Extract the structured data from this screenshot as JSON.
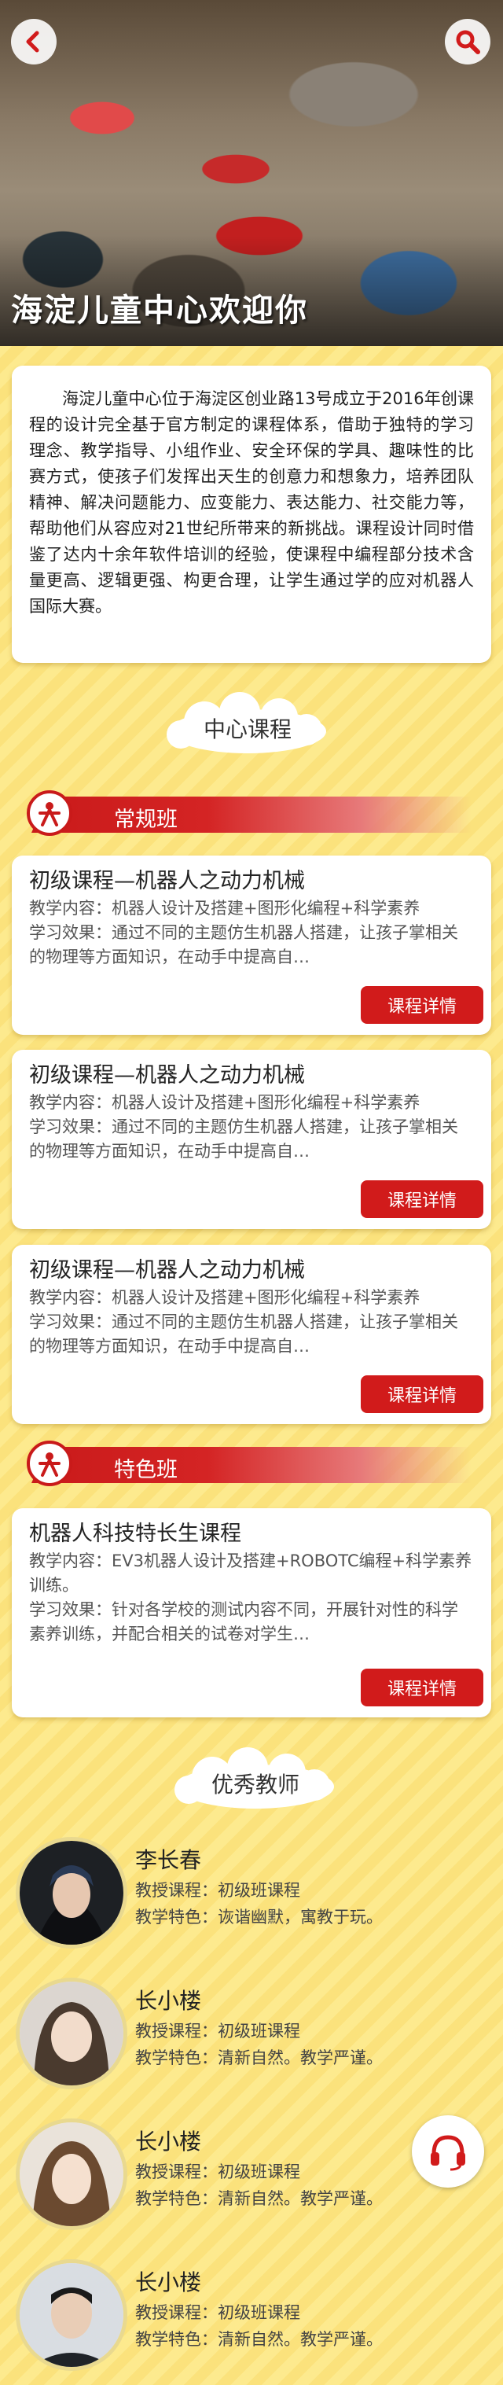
{
  "hero": {
    "title": "海淀儿童中心欢迎你"
  },
  "intro": {
    "text": "海淀儿童中心位于海淀区创业路13号成立于2016年创课程的设计完全基于官方制定的课程体系，借助于独特的学习理念、教学指导、小组作业、安全环保的学具、趣味性的比赛方式，使孩子们发挥出天生的创意力和想象力，培养团队精神、解决问题能力、应变能力、表达能力、社交能力等，帮助他们从容应对21世纪所带来的新挑战。课程设计同时借鉴了达内十余年软件培训的经验，使课程中编程部分技术含量更高、逻辑更强、构更合理，让学生通过学的应对机器人国际大赛。"
  },
  "sections": {
    "center_course": "中心课程",
    "regular": "常规班",
    "special": "特色班",
    "teachers": "优秀教师"
  },
  "regular_courses": [
    {
      "title": "初级课程—机器人之动力机械",
      "content": "教学内容：机器人设计及搭建+图形化编程+科学素养",
      "effect": "学习效果：通过不同的主题仿生机器人搭建，让孩子掌相关的物理等方面知识，在动手中提高自…",
      "button": "课程详情"
    },
    {
      "title": "初级课程—机器人之动力机械",
      "content": "教学内容：机器人设计及搭建+图形化编程+科学素养",
      "effect": "学习效果：通过不同的主题仿生机器人搭建，让孩子掌相关的物理等方面知识，在动手中提高自…",
      "button": "课程详情"
    },
    {
      "title": "初级课程—机器人之动力机械",
      "content": "教学内容：机器人设计及搭建+图形化编程+科学素养",
      "effect": "学习效果：通过不同的主题仿生机器人搭建，让孩子掌相关的物理等方面知识，在动手中提高自…",
      "button": "课程详情"
    }
  ],
  "special_course": {
    "title": "机器人科技特长生课程",
    "content": "教学内容：EV3机器人设计及搭建+ROBOTC编程+科学素养训练。",
    "effect": "学习效果：针对各学校的测试内容不同，开展针对性的科学素养训练，并配合相关的试卷对学生…",
    "button": "课程详情"
  },
  "teachers": [
    {
      "name": "李长春",
      "course": "教授课程：初级班课程",
      "feature": "教学特色：诙谐幽默，寓教于玩。"
    },
    {
      "name": "长小楼",
      "course": "教授课程：初级班课程",
      "feature": "教学特色：清新自然。教学严谨。"
    },
    {
      "name": "长小楼",
      "course": "教授课程：初级班课程",
      "feature": "教学特色：清新自然。教学严谨。"
    },
    {
      "name": "长小楼",
      "course": "教授课程：初级班课程",
      "feature": "教学特色：清新自然。教学严谨。"
    }
  ],
  "icons": {
    "back": "chevron-left-icon",
    "search": "search-icon",
    "logo": "center-logo-icon",
    "support": "headset-icon"
  },
  "colors": {
    "accent_red": "#d11b1b",
    "background_yellow": "#fdea8e",
    "card": "#ffffff"
  }
}
